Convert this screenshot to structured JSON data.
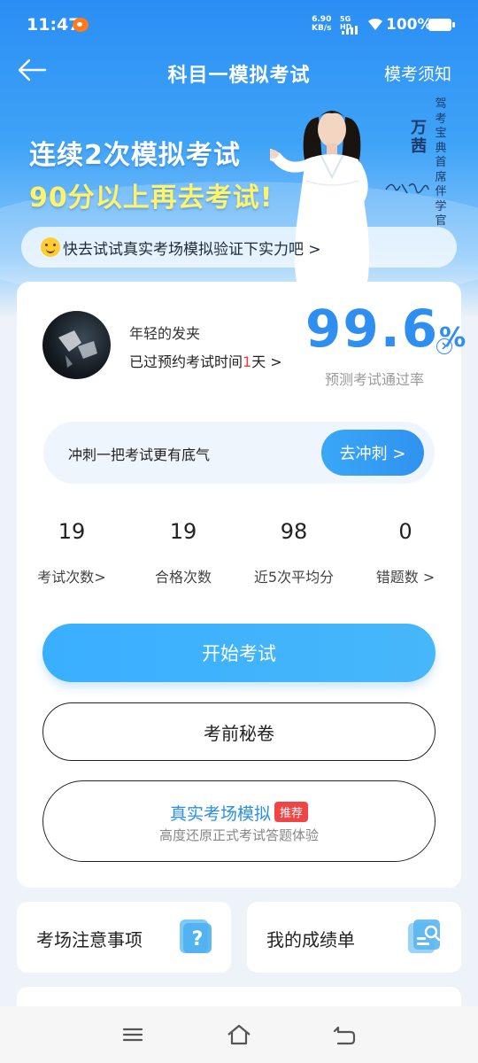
{
  "status_bar": {
    "time": "11:47",
    "net_speed_value": "6.90",
    "net_speed_unit": "KB/s",
    "network_type": "5G HD",
    "battery_text": "100%"
  },
  "nav": {
    "title": "科目一模拟考试",
    "right_link": "模考须知"
  },
  "banner": {
    "line1": "连续2次模拟考试",
    "line2": "90分以上再去考试!",
    "spokesperson_name": "万茜",
    "spokesperson_title": "驾考宝典首席伴学官",
    "tip": "快去试试真实考场模拟验证下实力吧 >"
  },
  "profile": {
    "username": "年轻的发夹",
    "appointment_prefix": "已过预约考试时间",
    "appointment_days": "1",
    "appointment_suffix": "天 >",
    "pass_rate_value": "99.6",
    "pass_rate_unit": "%",
    "pass_rate_label": "预测考试通过率"
  },
  "sprint": {
    "text": "冲刺一把考试更有底气",
    "button": "去冲刺 >"
  },
  "stats": [
    {
      "value": "19",
      "label": "考试次数>"
    },
    {
      "value": "19",
      "label": "合格次数"
    },
    {
      "value": "98",
      "label": "近5次平均分"
    },
    {
      "value": "0",
      "label": "错题数 >"
    }
  ],
  "actions": {
    "start_exam": "开始考试",
    "secret_paper": "考前秘卷",
    "real_sim_title": "真实考场模拟",
    "real_sim_badge": "推荐",
    "real_sim_sub": "高度还原正式考试答题体验"
  },
  "tiles": [
    {
      "label": "考场注意事项",
      "icon": "question-doc-icon"
    },
    {
      "label": "我的成绩单",
      "icon": "search-doc-icon"
    }
  ],
  "colors": {
    "accent": "#2f8ff0",
    "header_blue": "#2a8ef5",
    "highlight_yellow": "#fff36a",
    "badge_red": "#f04545"
  }
}
